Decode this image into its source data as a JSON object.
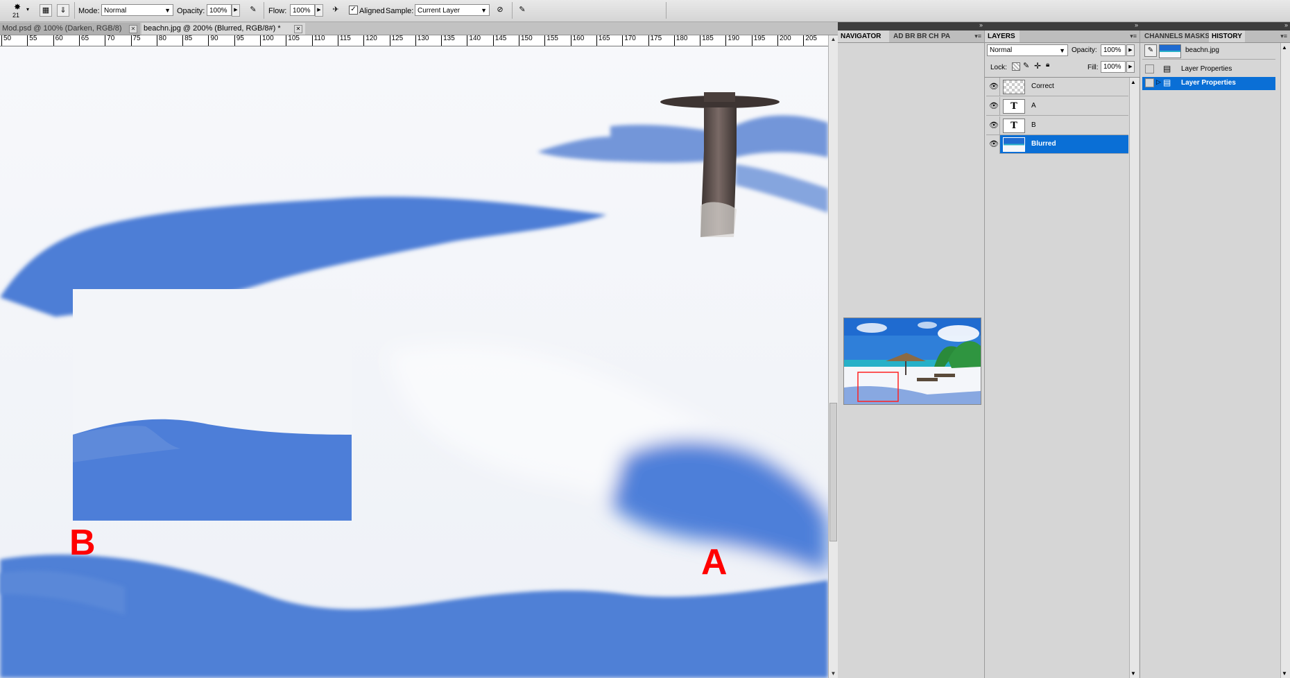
{
  "options_bar": {
    "brush_size": "21",
    "mode_label": "Mode:",
    "mode_value": "Normal",
    "opacity_label": "Opacity:",
    "opacity_value": "100%",
    "flow_label": "Flow:",
    "flow_value": "100%",
    "aligned_label": "Aligned",
    "aligned_checked": true,
    "sample_label": "Sample:",
    "sample_value": "Current Layer"
  },
  "document_tabs": [
    {
      "label": "Mod.psd @ 100% (Darken, RGB/8)",
      "active": false
    },
    {
      "label": "beachn.jpg @ 200% (Blurred, RGB/8#) *",
      "active": true
    }
  ],
  "ruler": {
    "labels": [
      "50",
      "55",
      "60",
      "65",
      "70",
      "75",
      "80",
      "85",
      "90",
      "95",
      "100",
      "105",
      "110",
      "115",
      "120",
      "125",
      "130",
      "135",
      "140",
      "145",
      "150",
      "155",
      "160",
      "165",
      "170",
      "175",
      "180",
      "185",
      "190",
      "195",
      "200",
      "205"
    ]
  },
  "canvas": {
    "label_a": "A",
    "label_b": "B",
    "label_color": "#ff0000"
  },
  "navigator_panel": {
    "tabs": [
      "NAVIGATOR",
      "AD",
      "BR",
      "BR",
      "CH",
      "PA"
    ]
  },
  "layers_panel": {
    "tab": "LAYERS",
    "blend_mode": "Normal",
    "opacity_label": "Opacity:",
    "opacity_value": "100%",
    "lock_label": "Lock:",
    "fill_label": "Fill:",
    "fill_value": "100%",
    "layers": [
      {
        "name": "Correct",
        "type": "empty",
        "selected": false
      },
      {
        "name": "A",
        "type": "text",
        "selected": false
      },
      {
        "name": "B",
        "type": "text",
        "selected": false
      },
      {
        "name": "Blurred",
        "type": "image",
        "selected": true
      }
    ]
  },
  "history_panel": {
    "tabs": [
      "CHANNELS",
      "MASKS",
      "HISTORY"
    ],
    "snapshot": "beachn.jpg",
    "states": [
      {
        "name": "Layer Properties",
        "selected": false
      },
      {
        "name": "Layer Properties",
        "selected": true
      }
    ]
  },
  "colors": {
    "selection": "#0a6fd6",
    "panel_bg": "#d6d6d6",
    "shadow_blue": "#5b86d6"
  }
}
